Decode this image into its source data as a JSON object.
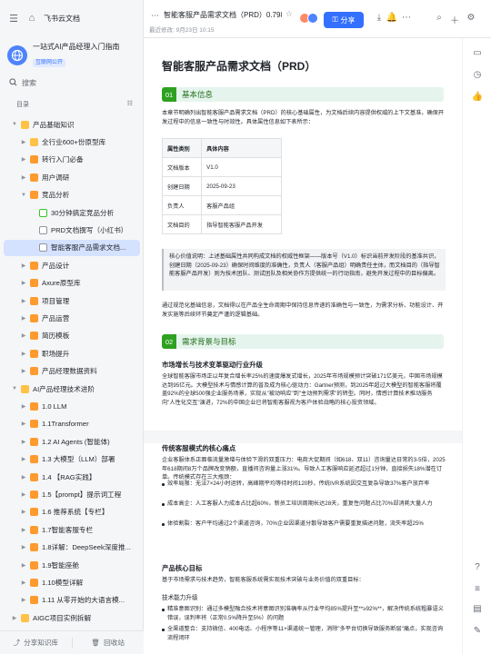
{
  "app": {
    "brand": "飞书云文档"
  },
  "knowledge_base": {
    "title": "一站式AI产品经理入门指南",
    "badge": "互联网公开"
  },
  "search": {
    "placeholder": "搜索"
  },
  "toc": {
    "label": "目录"
  },
  "tree": [
    {
      "label": "产品基础知识",
      "level": 0,
      "expanded": true,
      "icon": "folder"
    },
    {
      "label": "全行业600+份原型库",
      "level": 1,
      "icon": "folder"
    },
    {
      "label": "转行入门必备",
      "level": 1,
      "icon": "orange"
    },
    {
      "label": "用户调研",
      "level": 1,
      "icon": "orange"
    },
    {
      "label": "竞品分析",
      "level": 1,
      "expanded": true,
      "icon": "orange"
    },
    {
      "label": "30分钟搞定竞品分析",
      "level": 2,
      "icon": "green"
    },
    {
      "label": "PRD文档撰写（小红书）",
      "level": 2,
      "icon": "doc"
    },
    {
      "label": "智能客服产品需求文档...",
      "level": 2,
      "icon": "doc",
      "active": true
    },
    {
      "label": "产品设计",
      "level": 1,
      "icon": "orange"
    },
    {
      "label": "Axure原型库",
      "level": 1,
      "icon": "orange"
    },
    {
      "label": "项目管理",
      "level": 1,
      "icon": "orange"
    },
    {
      "label": "产品运营",
      "level": 1,
      "icon": "orange"
    },
    {
      "label": "简历模板",
      "level": 1,
      "icon": "orange"
    },
    {
      "label": "职场提升",
      "level": 1,
      "icon": "orange"
    },
    {
      "label": "产品经理数据资料",
      "level": 1,
      "icon": "orange"
    },
    {
      "label": "AI产品经理技术进阶",
      "level": 0,
      "expanded": true,
      "icon": "folder"
    },
    {
      "label": "1.0 LLM",
      "level": 1,
      "icon": "orange"
    },
    {
      "label": "1.1Transformer",
      "level": 1,
      "icon": "orange"
    },
    {
      "label": "1.2 AI Agents (智能体)",
      "level": 1,
      "icon": "orange"
    },
    {
      "label": "1.3 大模型（LLM）部署",
      "level": 1,
      "icon": "orange"
    },
    {
      "label": "1.4 【RAG实践】",
      "level": 1,
      "icon": "orange"
    },
    {
      "label": "1.5【prompt】提示词工程",
      "level": 1,
      "icon": "orange"
    },
    {
      "label": "1.6 推荐系统【专栏】",
      "level": 1,
      "icon": "orange"
    },
    {
      "label": "1.7智能客服专栏",
      "level": 1,
      "icon": "orange"
    },
    {
      "label": "1.8详解：DeepSeek深度推...",
      "level": 1,
      "icon": "orange"
    },
    {
      "label": "1.9智能座舱",
      "level": 1,
      "icon": "orange"
    },
    {
      "label": "1.10模型详解",
      "level": 1,
      "icon": "orange"
    },
    {
      "label": "1.11 从零开始的大语言模...",
      "level": 1,
      "icon": "orange"
    },
    {
      "label": "AIGC项目实例拆解",
      "level": 0,
      "icon": "folder"
    }
  ],
  "footer": {
    "share_kb": "分享知识库",
    "recycle": "回收站"
  },
  "header": {
    "title": "智能客服产品需求文档（PRD）0.798...",
    "meta": "最近修改: 9月23日 10:15",
    "share_label": "分享"
  },
  "doc": {
    "title": "智能客服产品需求文档（PRD）",
    "s1_num": "01",
    "s1_title": "基本信息",
    "intro": "本章节明确列出智能客服产品需求文档（PRD）的核心基础属性，为文档后续内容提供权威的上下文基准，确保开发过程中的信息一致性与时效性。具体属性信息如下表所示：",
    "table": {
      "headers": [
        "属性类别",
        "具体内容"
      ],
      "rows": [
        [
          "文档版本",
          "V1.0"
        ],
        [
          "创建日期",
          "2025-09-23"
        ],
        [
          "负责人",
          "客服产品组"
        ],
        [
          "文档目的",
          "指导智能客服产品开发"
        ]
      ]
    },
    "callout": "核心价值说明：上述基础属性共同构成文档的权威性框架——版本号（V1.0）标识当前开发阶段的基准共识，创建日期（2025-09-23）确保时间维度的准确性，负责人（客服产品组）明确责任主体，而文档目的（指导智能客服产品开发）则为技术团队、测试团队及相关协作方提供统一的行动指南，避免开发过程中的目标偏离。",
    "after_callout": "通过规范化基础信息，文档得以在产品全生命周期中保持信息传递的准确性与一致性，为需求分析、功能设计、开发实施等后续环节奠定严谨的逻辑基础。",
    "s2_num": "02",
    "s2_title": "需求背景与目标",
    "h_market": "市场增长与技术变革驱动行业升级",
    "market_p": "全球智能客服市场正以年复合增长率25%的速度爆发式增长，2025年市场规模预计突破171亿美元，中国市场规模达到95亿元。大模型技术与情感计算的普及成为核心驱动力：Gartner预测，到2025年超过大模型的智能客服将覆盖92%的全球500强企业服务场景，实现从\"被动响应\"到\"主动预判需求\"的转型。同时，情感计算技术推动服务向\"人性化交互\"演进，72%的中国企业已将智能客服视为客户体验战略的核心投资领域。",
    "h_pain": "传统客服模式的核心痛点",
    "pain_p": "企业客服体系正面临流量激增与体验下滑的双重压力：电商大促期间（如618、双11）咨询量达日常的3-5倍，2025年618期间8万个品牌改变销额，直播间咨询量上涨31%。导致人工客服响应延迟超过1分钟，直接损失18%潜在订单。传统模式存在三大瓶颈：",
    "pain_items": [
      "效率局限：无法7×24小时运转，高峰期平均等待时间120秒，传统IVR系统因交互复杂导致37%客户放弃率",
      "成本高企：人工客服人力成本占比超60%，新员工培训周期长达28天，重复性问题占比70%却消耗大量人力",
      "体验割裂：客户平均通过2个渠道咨询，70%企业因渠道分散导致客户需要重复描述问题，流失率超25%"
    ],
    "h_goal": "产品核心目标",
    "goal_p": "基于市场需求与技术趋势，智能客服系统需实现技术突破与业务价值的双重目标：",
    "h_tech": "技术能力升级",
    "tech_items": [
      "精准意图识别：通过多模型融合技术将意图识别准确率从行业平均85%提升至**≥92%**，解决传统系统粗暴语义错误，误判率将（正常0.5%降升至5%）的问题",
      "全渠道整合：支持微信、400电话、小程序等11+渠道统一管理，消除\"多平台切换导致服务断层\"痛点，实现咨询流程闭环"
    ]
  }
}
